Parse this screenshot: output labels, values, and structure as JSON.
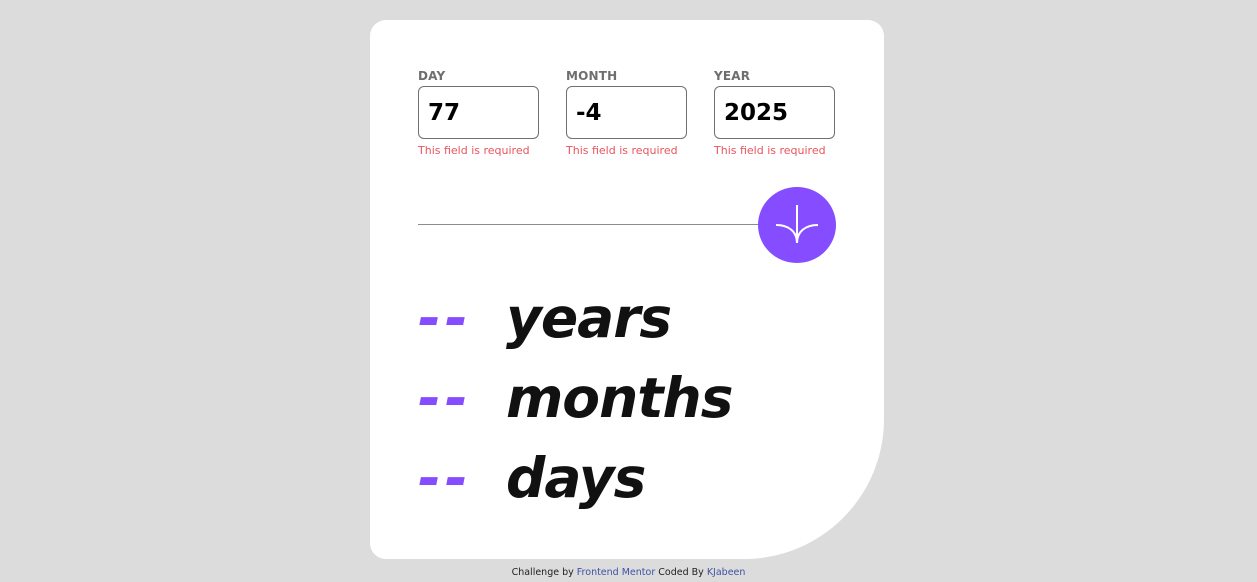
{
  "form": {
    "day": {
      "label": "DAY",
      "value": "77",
      "error": "This field is required"
    },
    "month": {
      "label": "MONTH",
      "value": "-4",
      "error": "This field is required"
    },
    "year": {
      "label": "YEAR",
      "value": "2025",
      "error": "This field is required"
    }
  },
  "submit": {
    "icon": "arrow-down-icon"
  },
  "results": {
    "years": {
      "value": "--",
      "unit": "years"
    },
    "months": {
      "value": "--",
      "unit": "months"
    },
    "days": {
      "value": "--",
      "unit": "days"
    }
  },
  "footer": {
    "prefix": "Challenge by",
    "challenge_link": "Frontend Mentor",
    "middle": "Coded By",
    "author_link": "KJabeen"
  },
  "colors": {
    "accent": "#854dff",
    "error": "#e9545e",
    "background": "#dcdcdc"
  }
}
